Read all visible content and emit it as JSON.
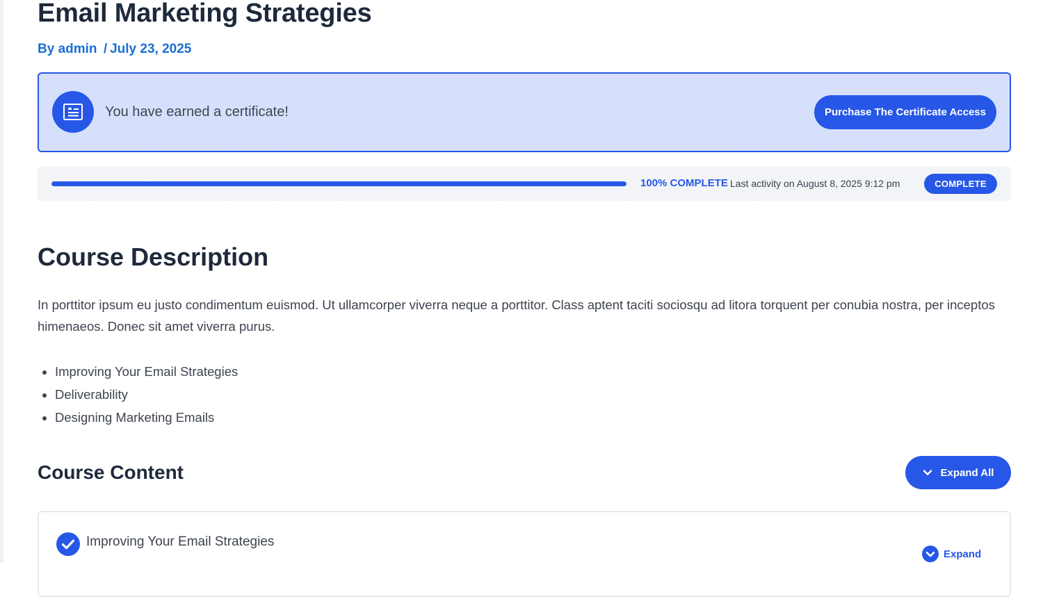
{
  "post": {
    "title": "Email Marketing Strategies",
    "by_label": "By",
    "author": "admin",
    "separator": "/",
    "date": "July 23, 2025"
  },
  "certificate": {
    "message": "You have earned a certificate!",
    "button_label": "Purchase The Certificate Access",
    "icon": "certificate-icon"
  },
  "progress": {
    "percent": 100,
    "percent_label": "100% COMPLETE",
    "last_activity": "Last activity on August 8, 2025 9:12 pm",
    "status_label": "COMPLETE"
  },
  "description": {
    "heading": "Course Description",
    "text": "In porttitor ipsum eu justo condimentum euismod. Ut ullamcorper viverra neque a porttitor. Class aptent taciti sociosqu ad litora torquent per conubia nostra, per inceptos himenaeos. Donec sit amet viverra purus.",
    "topics": [
      "Improving Your Email Strategies",
      "Deliverability",
      "Designing Marketing Emails"
    ]
  },
  "content": {
    "heading": "Course Content",
    "expand_all_label": "Expand All",
    "lessons": [
      {
        "title": "Improving Your Email Strategies",
        "expand_label": "Expand",
        "completed": true
      }
    ]
  },
  "colors": {
    "accent": "#2757e6",
    "link": "#1a6fd0",
    "banner_bg": "#d4defc",
    "heading": "#1e293b"
  }
}
